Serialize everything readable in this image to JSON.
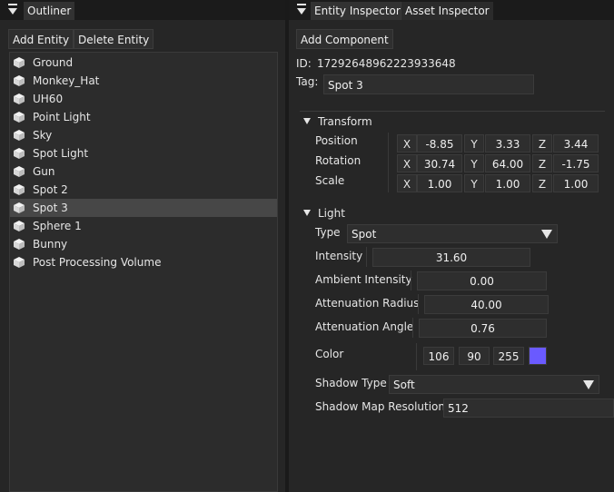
{
  "outliner": {
    "tab_label": "Outliner",
    "add_entity": "Add Entity",
    "delete_entity": "Delete Entity",
    "entities": [
      "Ground",
      "Monkey_Hat",
      "UH60",
      "Point Light",
      "Sky",
      "Spot Light",
      "Gun",
      "Spot 2",
      "Spot 3",
      "Sphere 1",
      "Bunny",
      "Post Processing Volume"
    ],
    "selected": "Spot 3"
  },
  "inspector": {
    "tab_entity": "Entity Inspector",
    "tab_asset": "Asset Inspector",
    "add_component": "Add Component",
    "id_label": "ID:",
    "id_value": "17292648962223933648",
    "tag_label": "Tag:",
    "tag_value": "Spot 3",
    "transform": {
      "header": "Transform",
      "position_label": "Position",
      "rotation_label": "Rotation",
      "scale_label": "Scale",
      "axis_x": "X",
      "axis_y": "Y",
      "axis_z": "Z",
      "position": [
        "-8.85",
        "3.33",
        "3.44"
      ],
      "rotation": [
        "30.74",
        "64.00",
        "-1.75"
      ],
      "scale": [
        "1.00",
        "1.00",
        "1.00"
      ]
    },
    "light": {
      "header": "Light",
      "type_label": "Type",
      "type_value": "Spot",
      "intensity_label": "Intensity",
      "intensity_value": "31.60",
      "ambient_label": "Ambient Intensity",
      "ambient_value": "0.00",
      "atten_radius_label": "Attenuation Radius",
      "atten_radius_value": "40.00",
      "atten_angle_label": "Attenuation Angle",
      "atten_angle_value": "0.76",
      "color_label": "Color",
      "color_r": "106",
      "color_g": "90",
      "color_b": "255",
      "color_hex": "#6a5aff",
      "shadow_type_label": "Shadow Type",
      "shadow_type_value": "Soft",
      "shadow_res_label": "Shadow Map Resolution",
      "shadow_res_value": "512"
    }
  },
  "icons": {
    "tab_menu": "tab-menu-icon",
    "entity": "cube-icon",
    "collapse": "collapse-arrow-icon",
    "dropdown": "dropdown-arrow-icon"
  }
}
